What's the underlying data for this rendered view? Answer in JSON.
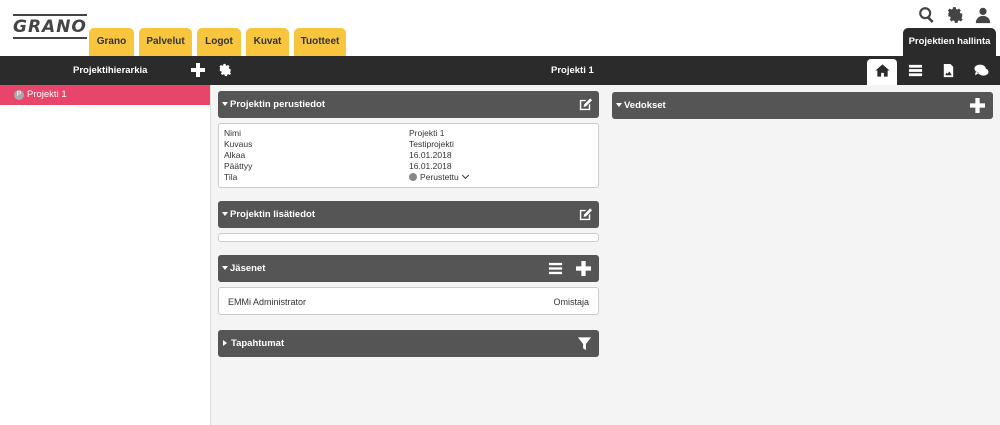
{
  "header": {
    "logo": "GRANO",
    "tabs": [
      "Grano",
      "Palvelut",
      "Logot",
      "Kuvat",
      "Tuotteet"
    ],
    "admin_tab": "Projektien hallinta",
    "icons": [
      "search-icon",
      "gear-icon",
      "user-icon"
    ]
  },
  "mainbar": {
    "hierarchy_title": "Projektihierarkia",
    "project_title": "Projekti 1",
    "view_tabs": [
      "home-icon",
      "list-icon",
      "image-icon",
      "comments-icon"
    ]
  },
  "sidebar": {
    "items": [
      {
        "badge": "P",
        "label": "Projekti 1"
      }
    ]
  },
  "panels": {
    "basic_info": {
      "title": "Projektin perustiedot",
      "rows": [
        {
          "label": "Nimi",
          "value": "Projekti 1"
        },
        {
          "label": "Kuvaus",
          "value": "Testiprojekti"
        },
        {
          "label": "Alkaa",
          "value": "16.01.2018"
        },
        {
          "label": "Päättyy",
          "value": "16.01.2018"
        },
        {
          "label": "Tila",
          "value": "Perustettu"
        }
      ]
    },
    "extra_info": {
      "title": "Projektin lisätiedot"
    },
    "members": {
      "title": "Jäsenet",
      "items": [
        {
          "name": "EMMi Administrator",
          "role": "Omistaja"
        }
      ]
    },
    "events": {
      "title": "Tapahtumat"
    },
    "proofs": {
      "title": "Vedokset"
    }
  },
  "colors": {
    "accent_yellow": "#f7c53e",
    "dark_bar": "#2b2b2b",
    "panel_header": "#555555",
    "selected_item": "#e9446a"
  }
}
